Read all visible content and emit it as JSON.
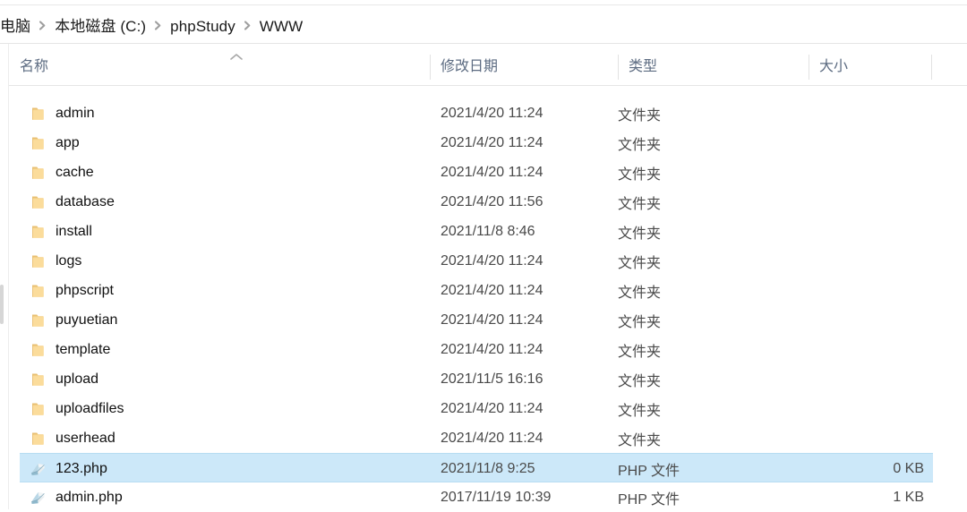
{
  "window": {
    "type": "file-explorer"
  },
  "breadcrumb": {
    "separator": "chevron-right-icon",
    "items": [
      {
        "label": "电脑"
      },
      {
        "label": "本地磁盘 (C:)"
      },
      {
        "label": "phpStudy"
      },
      {
        "label": "WWW"
      }
    ]
  },
  "columns": {
    "sort": {
      "column": "名称",
      "direction": "ascending",
      "icon": "chevron-up-icon"
    },
    "headers": [
      {
        "label": "名称"
      },
      {
        "label": "修改日期"
      },
      {
        "label": "类型"
      },
      {
        "label": "大小"
      }
    ]
  },
  "colors": {
    "selection_bg": "#cce8f9",
    "selection_border": "#b7ddf2",
    "header_text": "#5d6c82",
    "folder_icon": "#f2c75c",
    "php_icon": "#a8cde0"
  },
  "files": [
    {
      "name": "admin",
      "icon": "folder-icon",
      "date": "2021/4/20 11:24",
      "type": "文件夹",
      "size": "",
      "selected": false
    },
    {
      "name": "app",
      "icon": "folder-icon",
      "date": "2021/4/20 11:24",
      "type": "文件夹",
      "size": "",
      "selected": false
    },
    {
      "name": "cache",
      "icon": "folder-icon",
      "date": "2021/4/20 11:24",
      "type": "文件夹",
      "size": "",
      "selected": false
    },
    {
      "name": "database",
      "icon": "folder-icon",
      "date": "2021/4/20 11:56",
      "type": "文件夹",
      "size": "",
      "selected": false
    },
    {
      "name": "install",
      "icon": "folder-icon",
      "date": "2021/11/8 8:46",
      "type": "文件夹",
      "size": "",
      "selected": false
    },
    {
      "name": "logs",
      "icon": "folder-icon",
      "date": "2021/4/20 11:24",
      "type": "文件夹",
      "size": "",
      "selected": false
    },
    {
      "name": "phpscript",
      "icon": "folder-icon",
      "date": "2021/4/20 11:24",
      "type": "文件夹",
      "size": "",
      "selected": false
    },
    {
      "name": "puyuetian",
      "icon": "folder-icon",
      "date": "2021/4/20 11:24",
      "type": "文件夹",
      "size": "",
      "selected": false
    },
    {
      "name": "template",
      "icon": "folder-icon",
      "date": "2021/4/20 11:24",
      "type": "文件夹",
      "size": "",
      "selected": false
    },
    {
      "name": "upload",
      "icon": "folder-icon",
      "date": "2021/11/5 16:16",
      "type": "文件夹",
      "size": "",
      "selected": false
    },
    {
      "name": "uploadfiles",
      "icon": "folder-icon",
      "date": "2021/4/20 11:24",
      "type": "文件夹",
      "size": "",
      "selected": false
    },
    {
      "name": "userhead",
      "icon": "folder-icon",
      "date": "2021/4/20 11:24",
      "type": "文件夹",
      "size": "",
      "selected": false
    },
    {
      "name": "123.php",
      "icon": "php-file-icon",
      "date": "2021/11/8 9:25",
      "type": "PHP 文件",
      "size": "0 KB",
      "selected": true
    },
    {
      "name": "admin.php",
      "icon": "php-file-icon",
      "date": "2017/11/19 10:39",
      "type": "PHP 文件",
      "size": "1 KB",
      "selected": false
    }
  ]
}
